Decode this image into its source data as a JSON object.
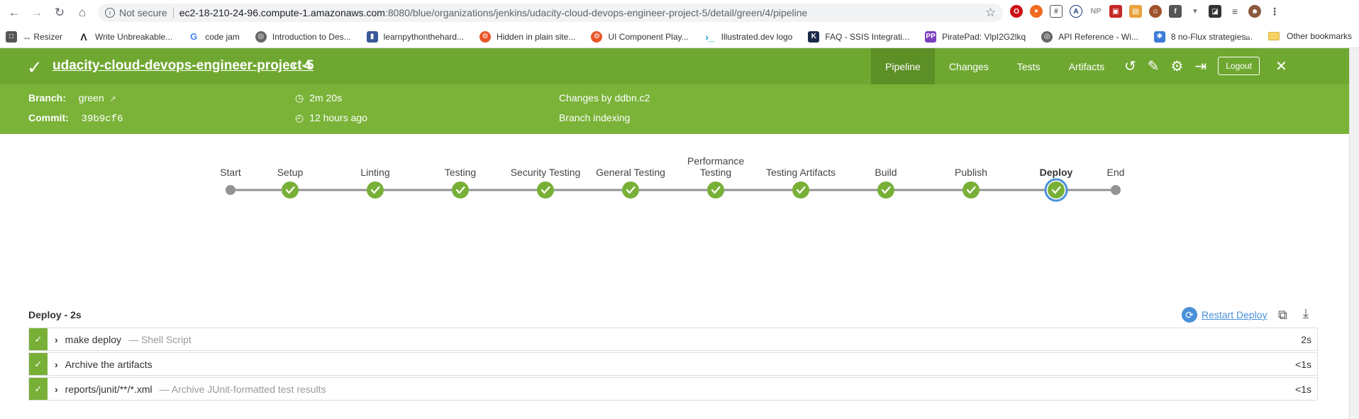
{
  "browser": {
    "security": "Not secure",
    "url_host": "ec2-18-210-24-96.compute-1.amazonaws.com",
    "url_path": ":8080/blue/organizations/jenkins/udacity-cloud-devops-engineer-project-5/detail/green/4/pipeline",
    "bookmarks": [
      {
        "label": "↔ Resizer",
        "color": "#555"
      },
      {
        "label": "Write Unbreakable...",
        "color": "#222"
      },
      {
        "label": "code jam",
        "color": "#4285f4"
      },
      {
        "label": "Introduction to Des...",
        "color": "#555"
      },
      {
        "label": "learnpythonthehard...",
        "color": "#3b5998"
      },
      {
        "label": "Hidden in plain site...",
        "color": "#e8562a"
      },
      {
        "label": "UI Component Play...",
        "color": "#e8562a"
      },
      {
        "label": "Illustrated.dev logo",
        "color": "#1ba3c6"
      },
      {
        "label": "FAQ - SSIS Integrati...",
        "color": "#1e2a4a"
      },
      {
        "label": "PiratePad: VlpI2G2lkq",
        "color": "#7b3fbf"
      },
      {
        "label": "API Reference - Wi...",
        "color": "#555"
      },
      {
        "label": "8 no-Flux strategies...",
        "color": "#3d7bd9"
      }
    ],
    "more": "»",
    "other_bookmarks": "Other bookmarks"
  },
  "header": {
    "project": "udacity-cloud-devops-engineer-project-5",
    "run_number": "4",
    "tabs": [
      "Pipeline",
      "Changes",
      "Tests",
      "Artifacts"
    ],
    "logout": "Logout"
  },
  "details": {
    "branch_label": "Branch:",
    "branch": "green",
    "commit_label": "Commit:",
    "commit": "39b9cf6",
    "duration": "2m 20s",
    "ago": "12 hours ago",
    "changes": "Changes by ddbn.c2",
    "cause": "Branch indexing"
  },
  "pipeline": {
    "stages": [
      {
        "label": "Start",
        "status": "start"
      },
      {
        "label": "Setup",
        "status": "success"
      },
      {
        "label": "Linting",
        "status": "success"
      },
      {
        "label": "Testing",
        "status": "success"
      },
      {
        "label": "Security Testing",
        "status": "success"
      },
      {
        "label": "General Testing",
        "status": "success"
      },
      {
        "label": "Performance Testing",
        "status": "success"
      },
      {
        "label": "Testing Artifacts",
        "status": "success"
      },
      {
        "label": "Build",
        "status": "success"
      },
      {
        "label": "Publish",
        "status": "success"
      },
      {
        "label": "Deploy",
        "status": "selected"
      },
      {
        "label": "End",
        "status": "end"
      }
    ],
    "colors": {
      "success": "#78b037",
      "line": "#949393",
      "selected_ring": "#4a90d9"
    }
  },
  "steps": {
    "title": "Deploy - 2s",
    "restart": "Restart Deploy",
    "rows": [
      {
        "name": "make deploy",
        "desc": "— Shell Script",
        "duration": "2s"
      },
      {
        "name": "Archive the artifacts",
        "desc": "",
        "duration": "<1s"
      },
      {
        "name": "reports/junit/**/*.xml",
        "desc": "— Archive JUnit-formatted test results",
        "duration": "<1s"
      }
    ]
  }
}
